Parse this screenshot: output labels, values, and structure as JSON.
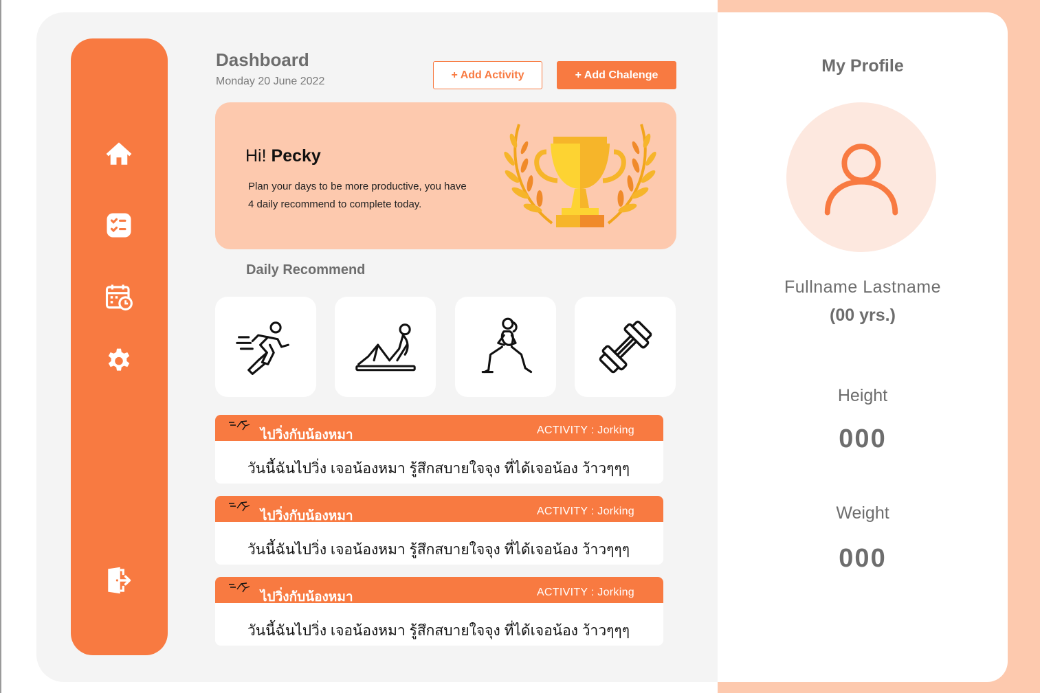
{
  "header": {
    "title": "Dashboard",
    "date": "Monday 20 June 2022",
    "add_activity_label": "+ Add Activity",
    "add_challenge_label": "+ Add Chalenge"
  },
  "sidebar": {
    "items": [
      {
        "icon": "home-icon"
      },
      {
        "icon": "checklist-icon"
      },
      {
        "icon": "calendar-clock-icon"
      },
      {
        "icon": "gear-icon"
      },
      {
        "icon": "logout-icon"
      }
    ]
  },
  "hero": {
    "greeting_prefix": "Hi!",
    "name": "Pecky",
    "line1": "Plan your days to be more productive, you have",
    "line2": "4 daily recommend to complete today."
  },
  "daily": {
    "title": "Daily  Recommend",
    "items": [
      {
        "icon": "running-icon"
      },
      {
        "icon": "situp-icon"
      },
      {
        "icon": "lunge-icon"
      },
      {
        "icon": "dumbbell-icon"
      }
    ]
  },
  "activities": [
    {
      "name": "ไปวิ่งกับน้องหมา",
      "type": "ACTIVITY : Jorking",
      "body": "วันนี้ฉันไปวิ่ง เจอน้องหมา รู้สึกสบายใจจุง ที่ได้เจอน้อง ว้าวๆๆๆ"
    },
    {
      "name": "ไปวิ่งกับน้องหมา",
      "type": "ACTIVITY : Jorking",
      "body": "วันนี้ฉันไปวิ่ง เจอน้องหมา รู้สึกสบายใจจุง ที่ได้เจอน้อง ว้าวๆๆๆ"
    },
    {
      "name": "ไปวิ่งกับน้องหมา",
      "type": "ACTIVITY : Jorking",
      "body": "วันนี้ฉันไปวิ่ง เจอน้องหมา รู้สึกสบายใจจุง ที่ได้เจอน้อง ว้าวๆๆๆ"
    }
  ],
  "profile": {
    "title": "My Profile",
    "fullname": "Fullname  Lastname",
    "age": "(00 yrs.)",
    "height_label": "Height",
    "height_value": "000",
    "weight_label": "Weight",
    "weight_value": "000"
  },
  "colors": {
    "accent": "#f87a41",
    "peach": "#fdc9ae",
    "panel": "#f4f4f4"
  }
}
